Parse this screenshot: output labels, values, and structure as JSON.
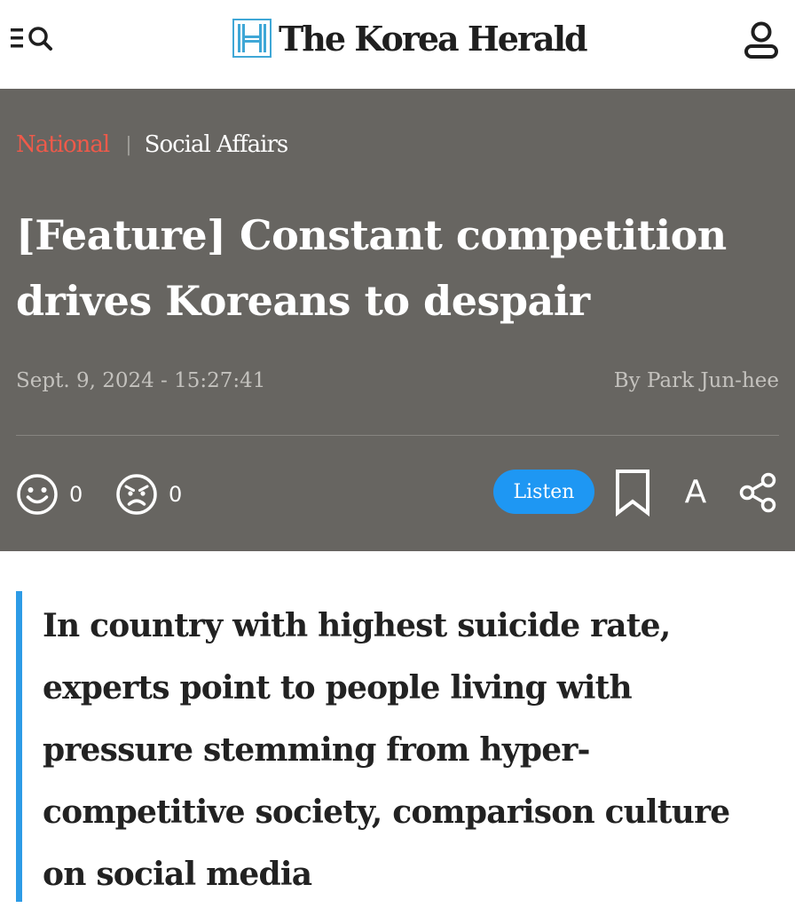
{
  "header": {
    "brand": "The Korea Herald",
    "icons": {
      "menu_search": "menu-search-icon",
      "account": "user-account-icon",
      "logo": "korea-herald-logo-icon"
    }
  },
  "article": {
    "section": "National",
    "separator": "|",
    "subsection": "Social Affairs",
    "headline": "[Feature] Constant competition drives Koreans to despair",
    "timestamp": "Sept. 9, 2024 - 15:27:41",
    "byline": "By Park Jun-hee",
    "subheadline": "In country with highest suicide rate, experts point to people living with pressure stemming from hyper-competitive society, comparison culture on social media"
  },
  "actions": {
    "like_count": "0",
    "angry_count": "0",
    "listen_label": "Listen",
    "font_label": "A",
    "icons": {
      "like": "smile-face-icon",
      "angry": "angry-face-icon",
      "bookmark": "bookmark-icon",
      "share": "share-icon"
    }
  },
  "colors": {
    "hero_background": "#676561",
    "section_accent": "#ef5a4a",
    "listen_button": "#1e97f3",
    "subhead_bar": "#2d9be6",
    "logo_accent": "#3fa7d6"
  }
}
